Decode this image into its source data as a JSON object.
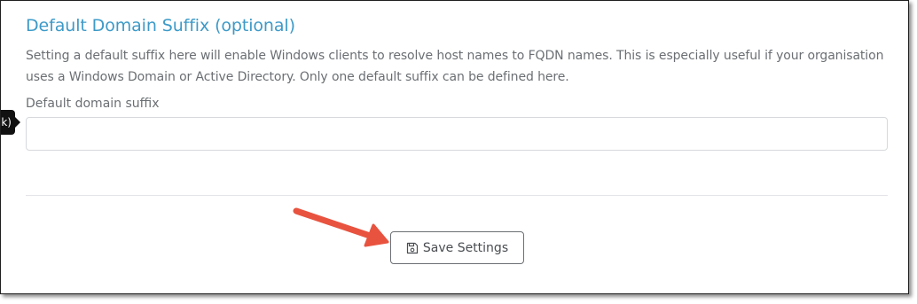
{
  "section": {
    "title": "Default Domain Suffix (optional)",
    "help_text": "Setting a default suffix here will enable Windows clients to resolve host names to FQDN names. This is especially useful if your organisation uses a Windows Domain or Active Directory. Only one default suffix can be defined here."
  },
  "field": {
    "label": "Default domain suffix",
    "value": "",
    "placeholder": ""
  },
  "tooltip": {
    "text": "k)"
  },
  "actions": {
    "save_label": "Save Settings",
    "save_icon": "floppy-disk-icon"
  },
  "colors": {
    "title": "#3d9ac8",
    "arrow": "#e8533f"
  }
}
